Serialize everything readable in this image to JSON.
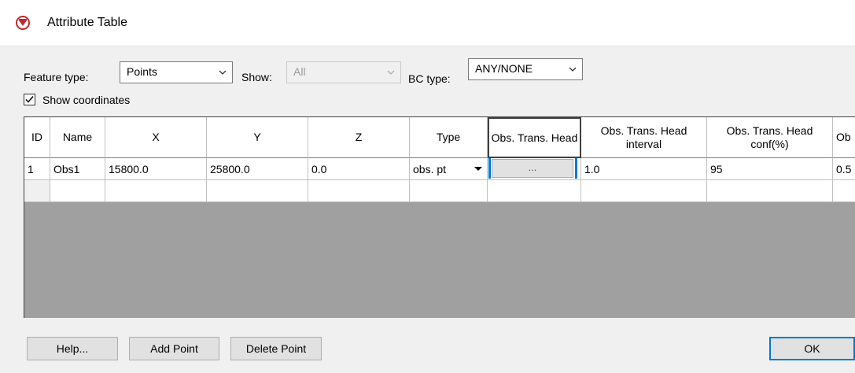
{
  "window": {
    "title": "Attribute Table",
    "icon": "attribute-table-app-icon"
  },
  "controls": {
    "feature_type_label": "Feature type:",
    "feature_type_value": "Points",
    "show_label": "Show:",
    "show_value": "All",
    "bc_type_label": "BC type:",
    "bc_type_value": "ANY/NONE",
    "show_coordinates_label": "Show coordinates",
    "show_coordinates_checked": true
  },
  "table": {
    "headers": [
      "ID",
      "Name",
      "X",
      "Y",
      "Z",
      "Type",
      "Obs. Trans. Head",
      "Obs. Trans. Head interval",
      "Obs. Trans. Head conf(%)",
      "Ob"
    ],
    "rows": [
      [
        "1",
        "Obs1",
        "15800.0",
        "25800.0",
        "0.0",
        "obs. pt",
        "...",
        "1.0",
        "95",
        "0.5"
      ]
    ]
  },
  "buttons": {
    "help": "Help...",
    "add_point": "Add Point",
    "delete_point": "Delete Point",
    "ok": "OK"
  },
  "colors": {
    "accent": "#0078d7",
    "grid_background": "#a0a0a0",
    "icon_red": "#c0282d"
  }
}
